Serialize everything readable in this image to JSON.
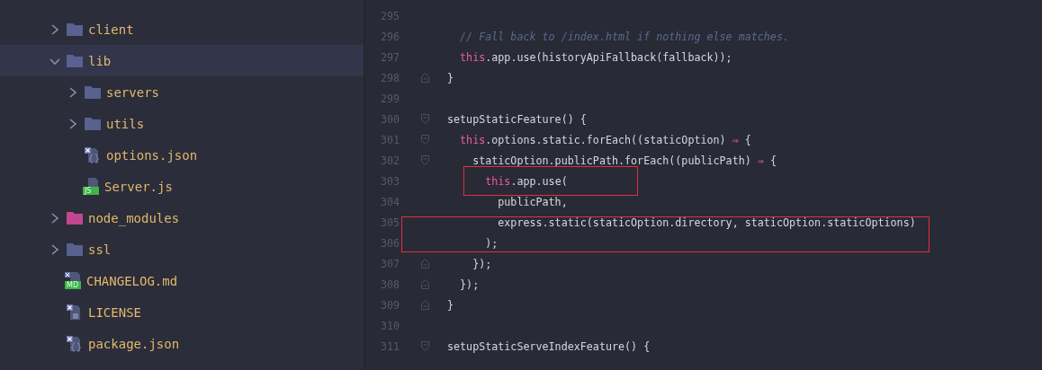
{
  "tree": [
    {
      "name": "client",
      "kind": "folder",
      "expanded": false,
      "selected": false
    },
    {
      "name": "lib",
      "kind": "folder",
      "expanded": true,
      "selected": true,
      "children": [
        {
          "name": "servers",
          "kind": "folder",
          "expanded": false,
          "selected": false
        },
        {
          "name": "utils",
          "kind": "folder",
          "expanded": false,
          "selected": false
        },
        {
          "name": "options.json",
          "kind": "json",
          "selected": false
        },
        {
          "name": "Server.js",
          "kind": "js",
          "selected": false,
          "badge": "JS"
        }
      ]
    },
    {
      "name": "node_modules",
      "kind": "folder",
      "expanded": false,
      "selected": false,
      "color": "#c2478f"
    },
    {
      "name": "ssl",
      "kind": "folder",
      "expanded": false,
      "selected": false
    },
    {
      "name": "CHANGELOG.md",
      "kind": "markdown",
      "selected": false,
      "badge": "MD"
    },
    {
      "name": "LICENSE",
      "kind": "text",
      "selected": false
    },
    {
      "name": "package.json",
      "kind": "json",
      "selected": false
    }
  ],
  "editor": {
    "lines": [
      {
        "number": "295"
      },
      {
        "number": "296",
        "tokens": [
          {
            "kind": "comment",
            "text": "  // Fall back to /index.html if nothing else matches."
          }
        ]
      },
      {
        "number": "297",
        "tokens": [
          {
            "kind": "keyword",
            "text": "  this"
          },
          {
            "kind": "plain",
            "text": ".app.use(historyApiFallback(fallback));"
          }
        ]
      },
      {
        "number": "298",
        "kind": "fold-end",
        "tokens": [
          {
            "kind": "plain",
            "text": "}"
          }
        ]
      },
      {
        "number": "299"
      },
      {
        "number": "300",
        "kind": "fold-start",
        "tokens": [
          {
            "kind": "plain",
            "text": "setupStaticFeature() {"
          }
        ]
      },
      {
        "number": "301",
        "kind": "fold-start",
        "tokens": [
          {
            "kind": "keyword",
            "text": "  this"
          },
          {
            "kind": "plain",
            "text": ".options.static.forEach((staticOption) "
          },
          {
            "kind": "operator",
            "text": "⇒"
          },
          {
            "kind": "plain",
            "text": " {"
          }
        ]
      },
      {
        "number": "302",
        "kind": "fold-start",
        "tokens": [
          {
            "kind": "plain",
            "text": "    staticOption.publicPath.forEach((publicPath) "
          },
          {
            "kind": "operator",
            "text": "⇒"
          },
          {
            "kind": "plain",
            "text": " {"
          }
        ]
      },
      {
        "number": "303",
        "tokens": [
          {
            "kind": "keyword",
            "text": "      this"
          },
          {
            "kind": "plain",
            "text": ".app.use("
          }
        ]
      },
      {
        "number": "304",
        "tokens": [
          {
            "kind": "plain",
            "text": "        publicPath,"
          }
        ]
      },
      {
        "number": "305",
        "tokens": [
          {
            "kind": "plain",
            "text": "        express.static(staticOption.directory, staticOption.staticOptions)"
          }
        ]
      },
      {
        "number": "306",
        "tokens": [
          {
            "kind": "plain",
            "text": "      );"
          }
        ]
      },
      {
        "number": "307",
        "kind": "fold-end",
        "tokens": [
          {
            "kind": "plain",
            "text": "    });"
          }
        ]
      },
      {
        "number": "308",
        "kind": "fold-end",
        "tokens": [
          {
            "kind": "plain",
            "text": "  });"
          }
        ]
      },
      {
        "number": "309",
        "kind": "fold-end",
        "tokens": [
          {
            "kind": "plain",
            "text": "}"
          }
        ]
      },
      {
        "number": "310"
      },
      {
        "number": "311",
        "kind": "fold-start",
        "tokens": [
          {
            "kind": "plain",
            "text": "setupStaticServeIndexFeature() {"
          }
        ]
      }
    ],
    "annotations": [
      {
        "kind": "box"
      },
      {
        "kind": "box"
      }
    ]
  }
}
